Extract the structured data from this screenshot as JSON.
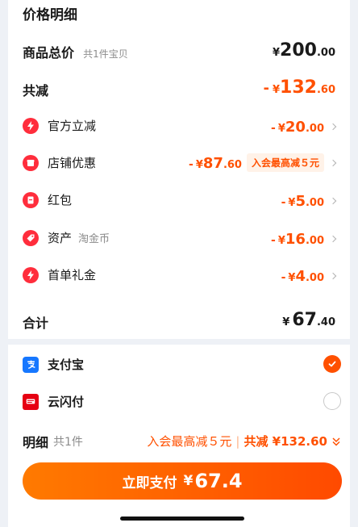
{
  "header": {
    "title": "价格明细"
  },
  "goods_total": {
    "label": "商品总价",
    "note": "共1件宝贝",
    "yen": "¥",
    "int": "200",
    "dec": ".00"
  },
  "total_discount": {
    "label": "共减",
    "prefix": "-",
    "yen": "¥",
    "int": "132",
    "dec": ".60"
  },
  "discount_items": [
    {
      "label": "官方立减",
      "note": "",
      "prefix": "-",
      "yen": "¥",
      "int": "20",
      "dec": ".00",
      "icon": "lightning-icon"
    },
    {
      "label": "店铺优惠",
      "note": "",
      "prefix": "-",
      "yen": "¥",
      "int": "87",
      "dec": ".60",
      "badge": "入会最高减５元",
      "icon": "shop-icon"
    },
    {
      "label": "红包",
      "note": "",
      "prefix": "-",
      "yen": "¥",
      "int": "5",
      "dec": ".00",
      "icon": "red-packet-icon"
    },
    {
      "label": "资产",
      "note": "淘金币",
      "prefix": "-",
      "yen": "¥",
      "int": "16",
      "dec": ".00",
      "icon": "tag-icon"
    },
    {
      "label": "首单礼金",
      "note": "",
      "prefix": "-",
      "yen": "¥",
      "int": "4",
      "dec": ".00",
      "icon": "lightning-icon"
    }
  ],
  "sum": {
    "label": "合计",
    "yen": "¥",
    "int": "67",
    "dec": ".40"
  },
  "payment_methods": [
    {
      "label": "支付宝",
      "selected": true,
      "icon": "alipay-icon"
    },
    {
      "label": "云闪付",
      "selected": false,
      "icon": "unionpay-icon"
    }
  ],
  "detail_bar": {
    "label": "明细",
    "count": "共1件",
    "promo": "入会最高减５元",
    "separator": "|",
    "discount": "共减 ¥132.60"
  },
  "pay_button": {
    "label": "立即支付",
    "yen": "¥",
    "amount": "67.4"
  },
  "colors": {
    "accent": "#ff5000",
    "icon_red": "#ff2d3c",
    "alipay_blue": "#1677ff",
    "badge_bg": "#fff2e8"
  }
}
